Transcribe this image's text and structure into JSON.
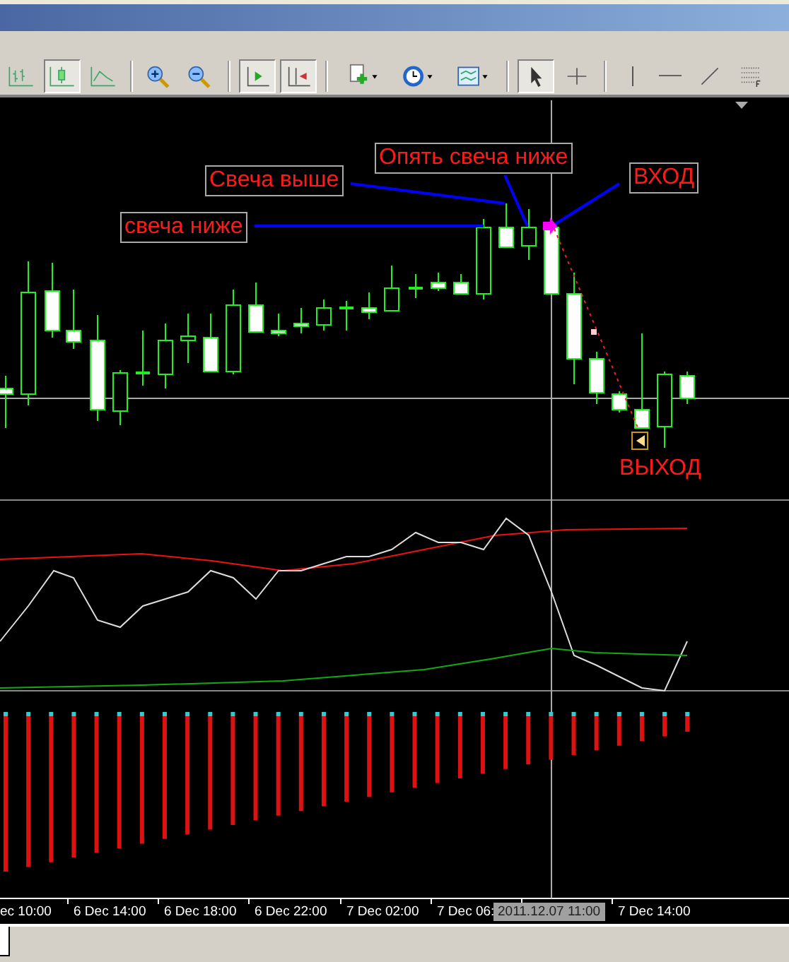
{
  "toolbar": [
    [
      {
        "kind": "bars",
        "pressed": false
      },
      {
        "kind": "candles",
        "pressed": true
      },
      {
        "kind": "line",
        "pressed": false
      }
    ],
    [
      {
        "kind": "zoom-in",
        "pressed": false
      },
      {
        "kind": "zoom-out",
        "pressed": false
      }
    ],
    [
      {
        "kind": "shift",
        "pressed": true
      },
      {
        "kind": "autoscroll",
        "pressed": true
      }
    ],
    [
      {
        "kind": "new-chart",
        "pressed": false
      },
      {
        "kind": "periods",
        "pressed": false
      },
      {
        "kind": "templates",
        "pressed": false
      }
    ],
    [
      {
        "kind": "cursor",
        "pressed": true
      },
      {
        "kind": "crosshair",
        "pressed": false
      }
    ],
    [
      {
        "kind": "vline",
        "pressed": false
      },
      {
        "kind": "hline",
        "pressed": false
      },
      {
        "kind": "trendline",
        "pressed": false
      },
      {
        "kind": "fibo",
        "pressed": false
      }
    ]
  ],
  "annotations": [
    {
      "text": "Опять свеча ниже",
      "boxed": true
    },
    {
      "text": "Свеча выше",
      "boxed": true
    },
    {
      "text": "ВХОД",
      "boxed": true
    },
    {
      "text": "свеча ниже",
      "boxed": true
    },
    {
      "text": "ВЫХОД",
      "boxed": false
    }
  ],
  "time_axis": [
    "ec 10:00",
    "6 Dec 14:00",
    "6 Dec 18:00",
    "6 Dec 22:00",
    "7 Dec 02:00",
    "7 Dec 06:",
    "7 Dec 14:00"
  ],
  "crosshair_time": "2011.12.07 11:00"
}
